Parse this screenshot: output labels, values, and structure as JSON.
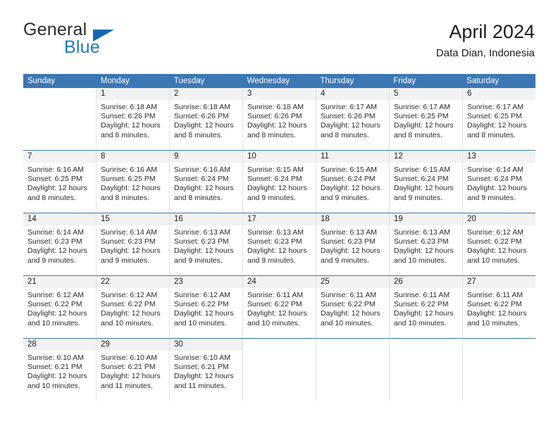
{
  "brand": {
    "word_one": "General",
    "word_two": "Blue",
    "triangle_icon": "brand-triangle-icon"
  },
  "header": {
    "title": "April 2024",
    "subtitle": "Data Dian, Indonesia"
  },
  "colors": {
    "header_blue": "#3b78b4",
    "brand_blue": "#1b77c8",
    "daynum_band": "#f2f2f2",
    "cell_border": "#e3e3e3"
  },
  "weekdays": [
    "Sunday",
    "Monday",
    "Tuesday",
    "Wednesday",
    "Thursday",
    "Friday",
    "Saturday"
  ],
  "weeks": [
    [
      {
        "day": "",
        "sunrise": "",
        "sunset": "",
        "daylight": "",
        "empty": true
      },
      {
        "day": "1",
        "sunrise": "Sunrise: 6:18 AM",
        "sunset": "Sunset: 6:26 PM",
        "daylight": "Daylight: 12 hours and 8 minutes."
      },
      {
        "day": "2",
        "sunrise": "Sunrise: 6:18 AM",
        "sunset": "Sunset: 6:26 PM",
        "daylight": "Daylight: 12 hours and 8 minutes."
      },
      {
        "day": "3",
        "sunrise": "Sunrise: 6:18 AM",
        "sunset": "Sunset: 6:26 PM",
        "daylight": "Daylight: 12 hours and 8 minutes."
      },
      {
        "day": "4",
        "sunrise": "Sunrise: 6:17 AM",
        "sunset": "Sunset: 6:26 PM",
        "daylight": "Daylight: 12 hours and 8 minutes."
      },
      {
        "day": "5",
        "sunrise": "Sunrise: 6:17 AM",
        "sunset": "Sunset: 6:25 PM",
        "daylight": "Daylight: 12 hours and 8 minutes."
      },
      {
        "day": "6",
        "sunrise": "Sunrise: 6:17 AM",
        "sunset": "Sunset: 6:25 PM",
        "daylight": "Daylight: 12 hours and 8 minutes."
      }
    ],
    [
      {
        "day": "7",
        "sunrise": "Sunrise: 6:16 AM",
        "sunset": "Sunset: 6:25 PM",
        "daylight": "Daylight: 12 hours and 8 minutes."
      },
      {
        "day": "8",
        "sunrise": "Sunrise: 6:16 AM",
        "sunset": "Sunset: 6:25 PM",
        "daylight": "Daylight: 12 hours and 8 minutes."
      },
      {
        "day": "9",
        "sunrise": "Sunrise: 6:16 AM",
        "sunset": "Sunset: 6:24 PM",
        "daylight": "Daylight: 12 hours and 8 minutes."
      },
      {
        "day": "10",
        "sunrise": "Sunrise: 6:15 AM",
        "sunset": "Sunset: 6:24 PM",
        "daylight": "Daylight: 12 hours and 9 minutes."
      },
      {
        "day": "11",
        "sunrise": "Sunrise: 6:15 AM",
        "sunset": "Sunset: 6:24 PM",
        "daylight": "Daylight: 12 hours and 9 minutes."
      },
      {
        "day": "12",
        "sunrise": "Sunrise: 6:15 AM",
        "sunset": "Sunset: 6:24 PM",
        "daylight": "Daylight: 12 hours and 9 minutes."
      },
      {
        "day": "13",
        "sunrise": "Sunrise: 6:14 AM",
        "sunset": "Sunset: 6:24 PM",
        "daylight": "Daylight: 12 hours and 9 minutes."
      }
    ],
    [
      {
        "day": "14",
        "sunrise": "Sunrise: 6:14 AM",
        "sunset": "Sunset: 6:23 PM",
        "daylight": "Daylight: 12 hours and 9 minutes."
      },
      {
        "day": "15",
        "sunrise": "Sunrise: 6:14 AM",
        "sunset": "Sunset: 6:23 PM",
        "daylight": "Daylight: 12 hours and 9 minutes."
      },
      {
        "day": "16",
        "sunrise": "Sunrise: 6:13 AM",
        "sunset": "Sunset: 6:23 PM",
        "daylight": "Daylight: 12 hours and 9 minutes."
      },
      {
        "day": "17",
        "sunrise": "Sunrise: 6:13 AM",
        "sunset": "Sunset: 6:23 PM",
        "daylight": "Daylight: 12 hours and 9 minutes."
      },
      {
        "day": "18",
        "sunrise": "Sunrise: 6:13 AM",
        "sunset": "Sunset: 6:23 PM",
        "daylight": "Daylight: 12 hours and 9 minutes."
      },
      {
        "day": "19",
        "sunrise": "Sunrise: 6:13 AM",
        "sunset": "Sunset: 6:23 PM",
        "daylight": "Daylight: 12 hours and 10 minutes."
      },
      {
        "day": "20",
        "sunrise": "Sunrise: 6:12 AM",
        "sunset": "Sunset: 6:22 PM",
        "daylight": "Daylight: 12 hours and 10 minutes."
      }
    ],
    [
      {
        "day": "21",
        "sunrise": "Sunrise: 6:12 AM",
        "sunset": "Sunset: 6:22 PM",
        "daylight": "Daylight: 12 hours and 10 minutes."
      },
      {
        "day": "22",
        "sunrise": "Sunrise: 6:12 AM",
        "sunset": "Sunset: 6:22 PM",
        "daylight": "Daylight: 12 hours and 10 minutes."
      },
      {
        "day": "23",
        "sunrise": "Sunrise: 6:12 AM",
        "sunset": "Sunset: 6:22 PM",
        "daylight": "Daylight: 12 hours and 10 minutes."
      },
      {
        "day": "24",
        "sunrise": "Sunrise: 6:11 AM",
        "sunset": "Sunset: 6:22 PM",
        "daylight": "Daylight: 12 hours and 10 minutes."
      },
      {
        "day": "25",
        "sunrise": "Sunrise: 6:11 AM",
        "sunset": "Sunset: 6:22 PM",
        "daylight": "Daylight: 12 hours and 10 minutes."
      },
      {
        "day": "26",
        "sunrise": "Sunrise: 6:11 AM",
        "sunset": "Sunset: 6:22 PM",
        "daylight": "Daylight: 12 hours and 10 minutes."
      },
      {
        "day": "27",
        "sunrise": "Sunrise: 6:11 AM",
        "sunset": "Sunset: 6:22 PM",
        "daylight": "Daylight: 12 hours and 10 minutes."
      }
    ],
    [
      {
        "day": "28",
        "sunrise": "Sunrise: 6:10 AM",
        "sunset": "Sunset: 6:21 PM",
        "daylight": "Daylight: 12 hours and 10 minutes."
      },
      {
        "day": "29",
        "sunrise": "Sunrise: 6:10 AM",
        "sunset": "Sunset: 6:21 PM",
        "daylight": "Daylight: 12 hours and 11 minutes."
      },
      {
        "day": "30",
        "sunrise": "Sunrise: 6:10 AM",
        "sunset": "Sunset: 6:21 PM",
        "daylight": "Daylight: 12 hours and 11 minutes."
      },
      {
        "day": "",
        "sunrise": "",
        "sunset": "",
        "daylight": "",
        "empty": true
      },
      {
        "day": "",
        "sunrise": "",
        "sunset": "",
        "daylight": "",
        "empty": true
      },
      {
        "day": "",
        "sunrise": "",
        "sunset": "",
        "daylight": "",
        "empty": true
      },
      {
        "day": "",
        "sunrise": "",
        "sunset": "",
        "daylight": "",
        "empty": true
      }
    ]
  ]
}
